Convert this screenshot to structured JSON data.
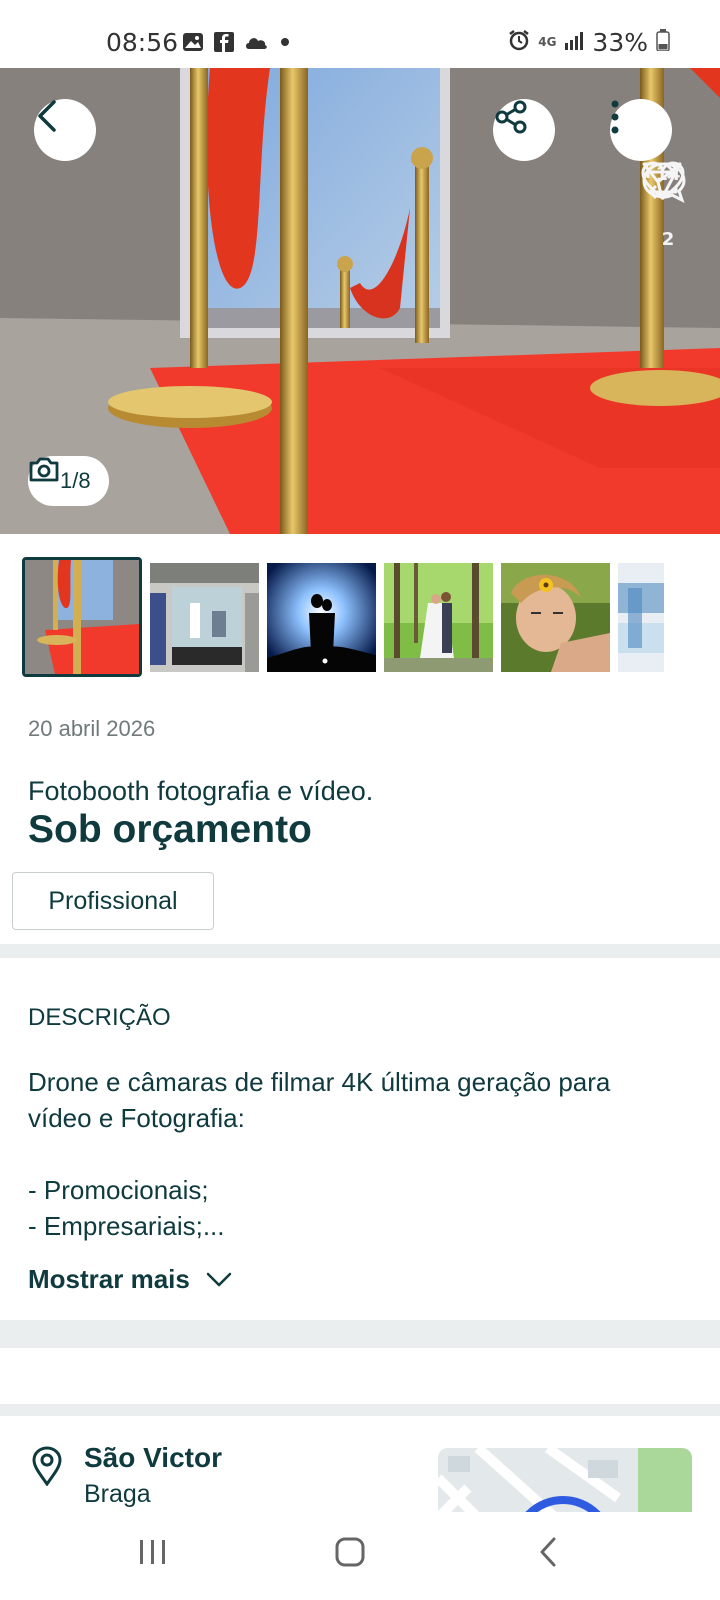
{
  "status_bar": {
    "time": "08:56",
    "battery": "33%",
    "network": "4G",
    "icons_left": [
      "gallery-icon",
      "facebook-icon",
      "cloud-icon",
      "dot-icon"
    ],
    "icons_right": [
      "alarm-icon",
      "network-4g-icon",
      "signal-icon",
      "battery-icon"
    ]
  },
  "gallery": {
    "counter": "1/8",
    "likes": "14",
    "reposts": "2",
    "thumbnail_count": 6
  },
  "ad": {
    "date": "20 abril 2026",
    "title": "Fotobooth  fotografia e vídeo.",
    "price": "Sob orçamento",
    "tag": "Profissional"
  },
  "description": {
    "heading": "DESCRIÇÃO",
    "lines": [
      "Drone e câmaras de filmar 4K última geração para",
      "vídeo e Fotografia:",
      "",
      "- Promocionais;",
      "- Empresariais;..."
    ],
    "show_more": "Mostrar mais"
  },
  "location": {
    "city": "São Victor",
    "region": "Braga"
  },
  "colors": {
    "primary": "#0f3a3e",
    "divider": "#ebeeef",
    "carpet": "#f23a2c",
    "gold": "#c79a3c"
  }
}
